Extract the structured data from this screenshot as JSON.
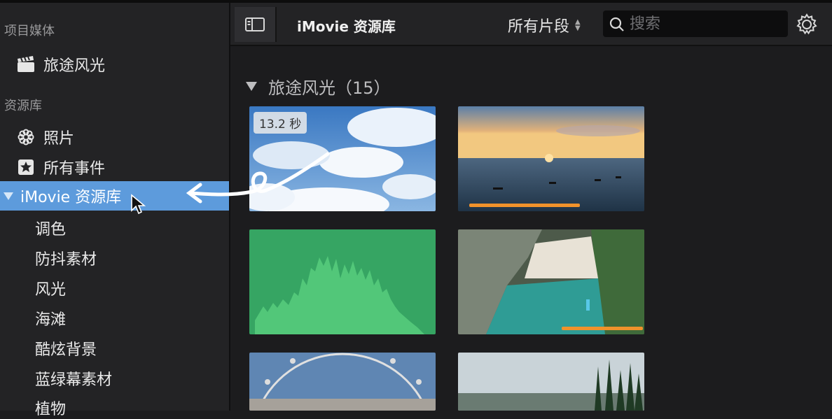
{
  "sidebar": {
    "project_section": "项目媒体",
    "project_item": "旅途风光",
    "library_section": "资源库",
    "photos": "照片",
    "all_events": "所有事件",
    "library_name": "iMovie 资源库",
    "events": [
      "调色",
      "防抖素材",
      "风光",
      "海滩",
      "酷炫背景",
      "蓝绿幕素材",
      "植物"
    ]
  },
  "toolbar": {
    "title": "iMovie 资源库",
    "filter": "所有片段",
    "search_placeholder": "搜索"
  },
  "browser": {
    "event_header": "旅途风光（15）",
    "clips": [
      {
        "label": "sky-clouds",
        "duration": "13.2 秒",
        "favorite_fraction": 0
      },
      {
        "label": "sunset-sea",
        "favorite_fraction": 0.6
      },
      {
        "label": "audio-waveform",
        "favorite_fraction": 0
      },
      {
        "label": "beach-cove",
        "favorite_fraction": 0.45
      },
      {
        "label": "ferris-wheel"
      },
      {
        "label": "forest-lake"
      }
    ]
  },
  "colors": {
    "selection": "#5d9bdc",
    "favorite": "#f0922b",
    "audio_clip": "#36a563"
  }
}
